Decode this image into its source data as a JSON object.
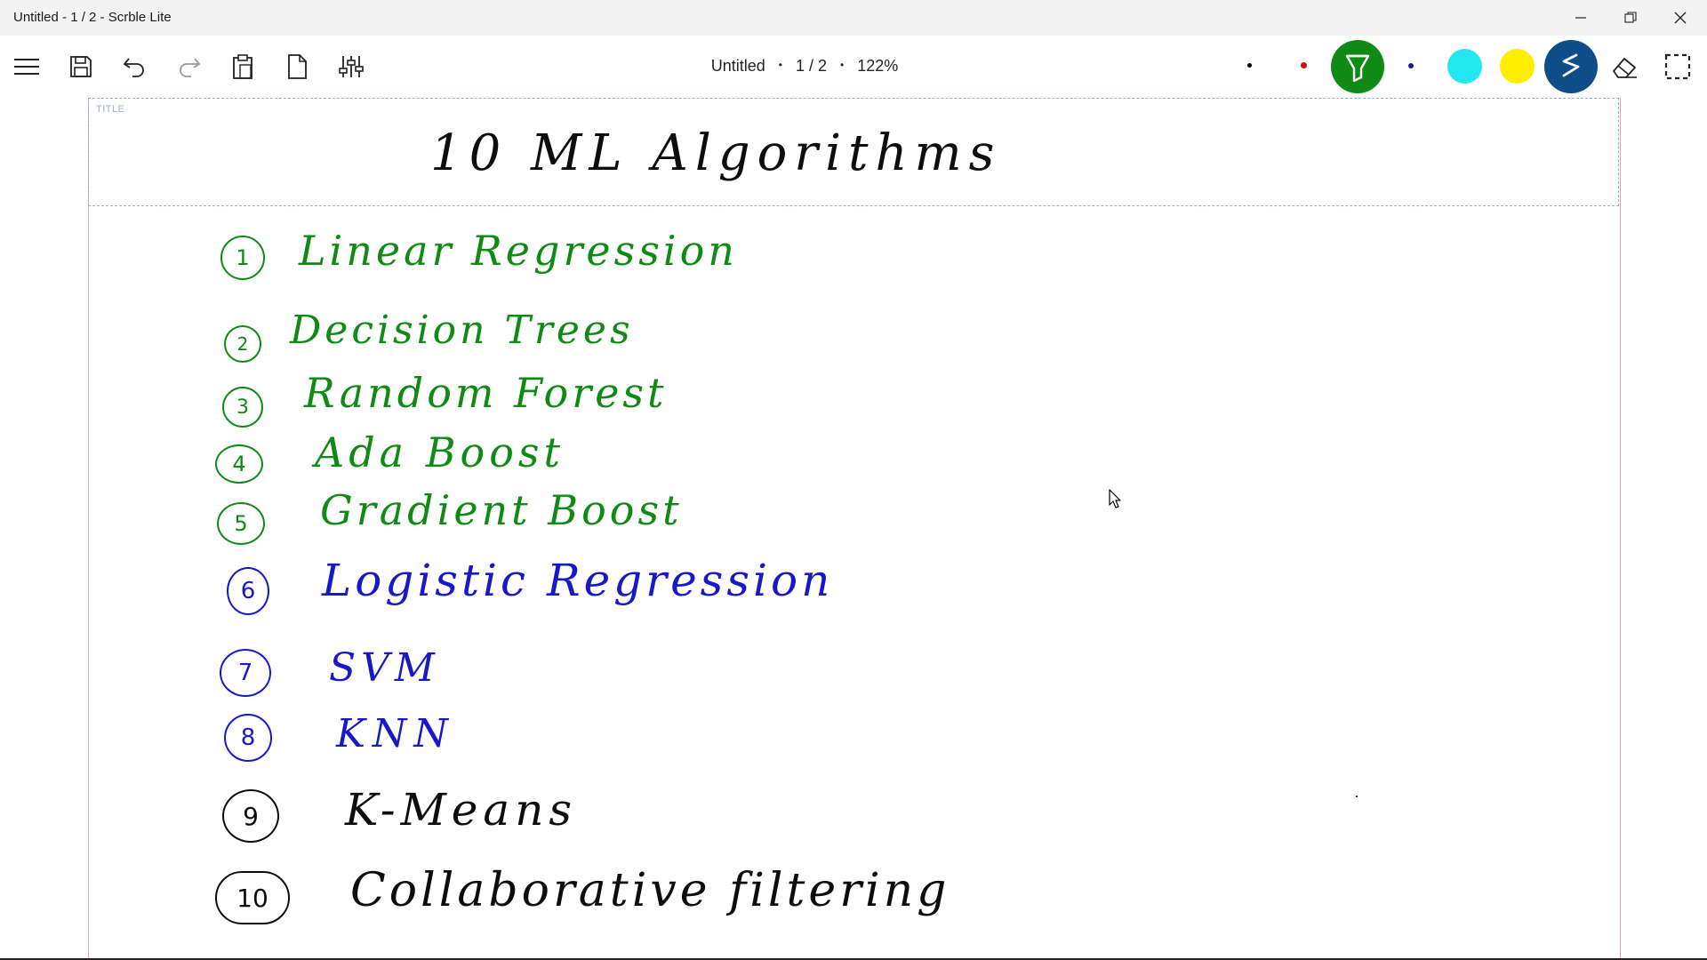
{
  "window": {
    "title": "Untitled - 1 / 2 - Scrble Lite"
  },
  "toolbar": {
    "doc_name": "Untitled",
    "page": "1 / 2",
    "zoom": "122%",
    "pen_colors": {
      "small_black": "#000000",
      "small_red": "#d01010",
      "highlighter_green": "#0f8a14",
      "small_blue": "#1a1aa0",
      "cyan": "#22e7ef",
      "yellow": "#ffee00",
      "selected_blue": "#0e4d8a"
    }
  },
  "canvas": {
    "title_tag": "TITLE",
    "title_text": "10  ML  Algorithms",
    "items": [
      {
        "num": "1",
        "label": "Linear  Regression"
      },
      {
        "num": "2",
        "label": "Decision  Trees"
      },
      {
        "num": "3",
        "label": "Random  Forest"
      },
      {
        "num": "4",
        "label": "Ada  Boost"
      },
      {
        "num": "5",
        "label": "Gradient  Boost"
      },
      {
        "num": "6",
        "label": "Logistic  Regression"
      },
      {
        "num": "7",
        "label": "SVM"
      },
      {
        "num": "8",
        "label": "KNN"
      },
      {
        "num": "9",
        "label": "K-Means"
      },
      {
        "num": "10",
        "label": "Collaborative  filtering"
      }
    ]
  }
}
